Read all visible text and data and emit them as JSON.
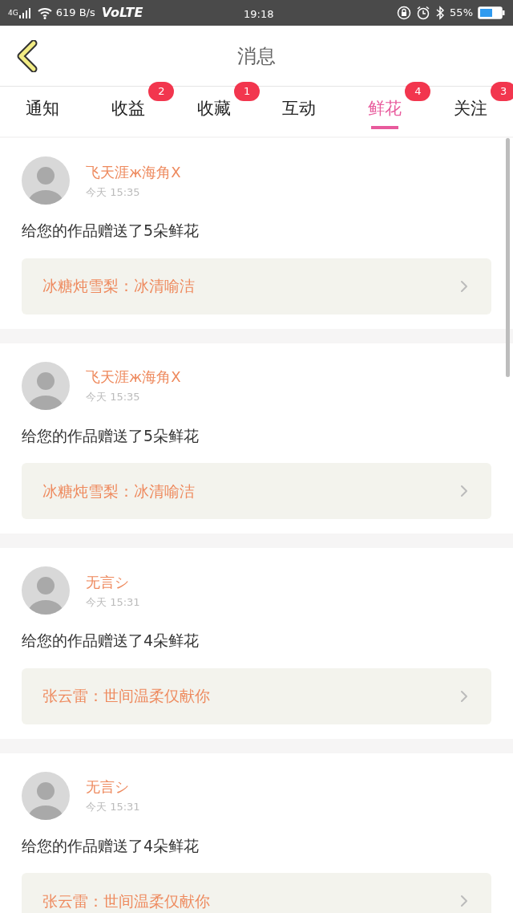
{
  "status_bar": {
    "network": "4G",
    "speed": "619 B/s",
    "volte": "VoLTE",
    "time": "19:18",
    "battery": "55%"
  },
  "header": {
    "title": "消息"
  },
  "tabs": [
    {
      "label": "通知",
      "selected": false
    },
    {
      "label": "收益",
      "badge": "2",
      "selected": false
    },
    {
      "label": "收藏",
      "badge": "1",
      "selected": false
    },
    {
      "label": "互动",
      "selected": false
    },
    {
      "label": "鲜花",
      "badge": "4",
      "selected": true
    },
    {
      "label": "关注",
      "badge": "3",
      "selected": false
    }
  ],
  "messages": [
    {
      "sender": "飞天涯ж海角X",
      "time": "今天 15:35",
      "text": "给您的作品赠送了5朵鲜花",
      "work": "冰糖炖雪梨：冰清喻洁"
    },
    {
      "sender": "飞天涯ж海角X",
      "time": "今天 15:35",
      "text": "给您的作品赠送了5朵鲜花",
      "work": "冰糖炖雪梨：冰清喻洁"
    },
    {
      "sender": "无言シ",
      "time": "今天 15:31",
      "text": "给您的作品赠送了4朵鲜花",
      "work": "张云雷：世间温柔仅献你"
    },
    {
      "sender": "无言シ",
      "time": "今天 15:31",
      "text": "给您的作品赠送了4朵鲜花",
      "work": "张云雷：世间温柔仅献你"
    }
  ]
}
